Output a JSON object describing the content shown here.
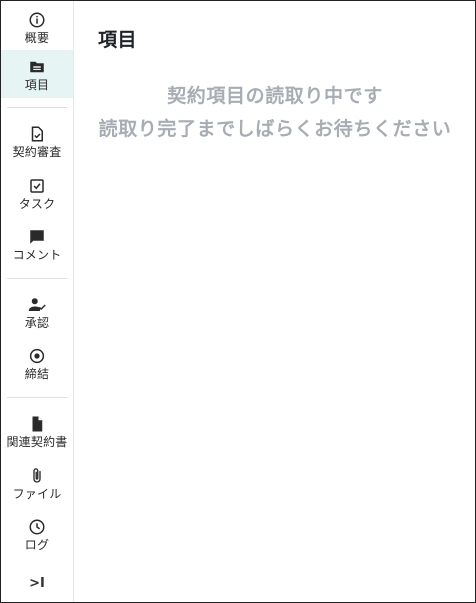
{
  "sidebar": {
    "items": [
      {
        "label": "概要",
        "icon": "info-icon"
      },
      {
        "label": "項目",
        "icon": "folder-open-icon"
      },
      {
        "label": "契約審査",
        "icon": "document-check-icon"
      },
      {
        "label": "タスク",
        "icon": "checkbox-icon"
      },
      {
        "label": "コメント",
        "icon": "comment-icon"
      },
      {
        "label": "承認",
        "icon": "user-check-icon"
      },
      {
        "label": "締結",
        "icon": "target-icon"
      },
      {
        "label": "関連契約書",
        "icon": "file-icon"
      },
      {
        "label": "ファイル",
        "icon": "paperclip-icon"
      },
      {
        "label": "ログ",
        "icon": "clock-icon"
      }
    ],
    "active_index": 1,
    "collapse_label": ">I"
  },
  "main": {
    "title": "項目",
    "loading_line1": "契約項目の読取り中です",
    "loading_line2": "読取り完了までしばらくお待ちください"
  },
  "colors": {
    "active_bg": "#e6f5f3",
    "loading_text": "#a8adb4",
    "icon": "#2a2a2a"
  }
}
